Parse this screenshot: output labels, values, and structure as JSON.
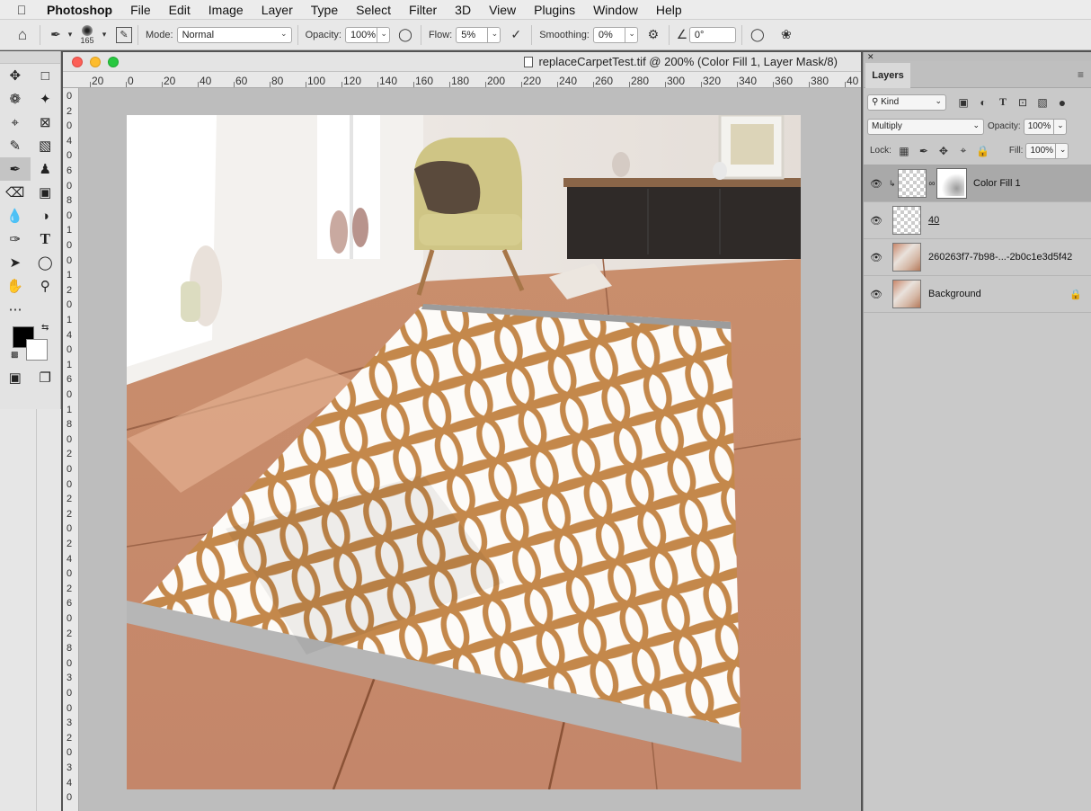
{
  "menubar": {
    "app": "Photoshop",
    "items": [
      "File",
      "Edit",
      "Image",
      "Layer",
      "Type",
      "Select",
      "Filter",
      "3D",
      "View",
      "Plugins",
      "Window",
      "Help"
    ]
  },
  "options": {
    "brush_size": "165",
    "mode_label": "Mode:",
    "mode_value": "Normal",
    "opacity_label": "Opacity:",
    "opacity_value": "100%",
    "flow_label": "Flow:",
    "flow_value": "5%",
    "smoothing_label": "Smoothing:",
    "smoothing_value": "0%",
    "angle_value": "0°"
  },
  "document": {
    "title": "replaceCarpetTest.tif @ 200% (Color Fill 1, Layer Mask/8)",
    "hruler": [
      "20",
      "0",
      "20",
      "40",
      "60",
      "80",
      "100",
      "120",
      "140",
      "160",
      "180",
      "200",
      "220",
      "240",
      "260",
      "280",
      "300",
      "320",
      "340",
      "360",
      "380",
      "40"
    ],
    "vruler": [
      "0",
      "2",
      "0",
      "4",
      "0",
      "6",
      "0",
      "8",
      "0",
      "1",
      "0",
      "0",
      "1",
      "2",
      "0",
      "1",
      "4",
      "0",
      "1",
      "6",
      "0",
      "1",
      "8",
      "0",
      "2",
      "0",
      "0",
      "2",
      "2",
      "0",
      "2",
      "4",
      "0",
      "2",
      "6",
      "0",
      "2",
      "8",
      "0",
      "3",
      "0",
      "0",
      "3",
      "2",
      "0",
      "3",
      "4",
      "0",
      "3"
    ]
  },
  "layers_panel": {
    "tab": "Layers",
    "filter_kind": "Kind",
    "blend_mode": "Multiply",
    "opacity_label": "Opacity:",
    "opacity_value": "100%",
    "lock_label": "Lock:",
    "fill_label": "Fill:",
    "fill_value": "100%",
    "layers": [
      {
        "name": "Color Fill 1",
        "selected": true
      },
      {
        "name": "40",
        "selected": false
      },
      {
        "name": "260263f7-7b98-...-2b0c1e3d5f42",
        "selected": false
      },
      {
        "name": "Background",
        "selected": false
      }
    ]
  },
  "colors": {
    "foreground": "#000000",
    "background": "#ffffff",
    "rug_pattern": "#c4884b",
    "floor": "#c48a6a"
  }
}
